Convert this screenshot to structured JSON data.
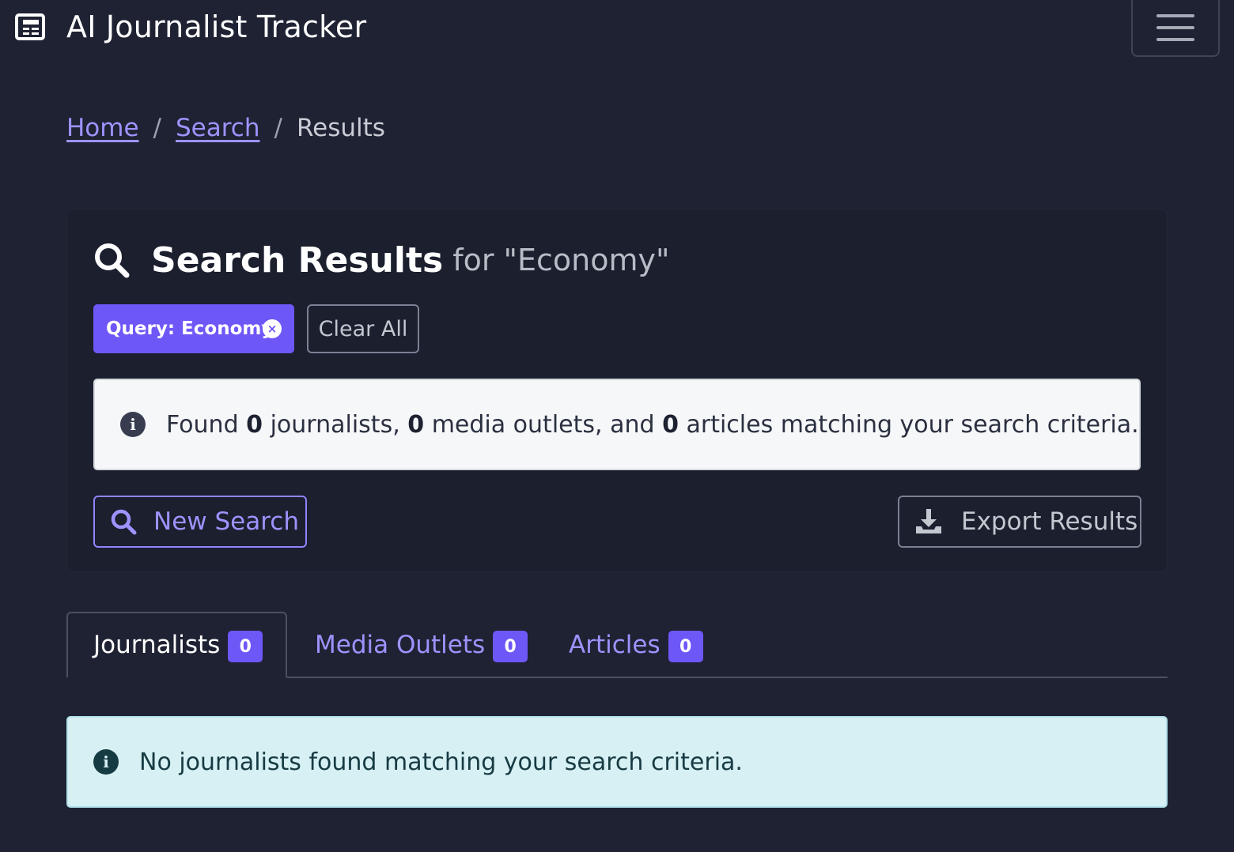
{
  "app": {
    "title": "AI Journalist Tracker",
    "brand_icon": "newspaper-icon",
    "menu_icon": "hamburger-menu-icon"
  },
  "breadcrumb": {
    "items": [
      {
        "label": "Home",
        "link": true
      },
      {
        "label": "Search",
        "link": true
      },
      {
        "label": "Results",
        "link": false
      }
    ],
    "separator": "/"
  },
  "results_card": {
    "title": "Search Results",
    "subtitle": "for \"Economy\"",
    "title_icon": "search-icon",
    "filter_chip": {
      "label": "Query: Economy",
      "remove_icon": "close-circle-icon",
      "remove_glyph": "×"
    },
    "clear_all_label": "Clear All",
    "summary": {
      "prefix": "Found",
      "journalists_count": "0",
      "journalists_text": "journalists,",
      "outlets_count": "0",
      "outlets_text": "media outlets, and",
      "articles_count": "0",
      "articles_text": "articles matching your search criteria.",
      "icon": "info-icon",
      "icon_glyph": "i"
    },
    "new_search_label": "New Search",
    "export_label": "Export Results",
    "export_icon": "download-icon"
  },
  "tabs": [
    {
      "label": "Journalists",
      "count": "0",
      "active": true
    },
    {
      "label": "Media Outlets",
      "count": "0",
      "active": false
    },
    {
      "label": "Articles",
      "count": "0",
      "active": false
    }
  ],
  "empty_state": {
    "message": "No journalists found matching your search criteria.",
    "icon": "info-icon",
    "icon_glyph": "i"
  },
  "colors": {
    "background": "#1e2233",
    "accent": "#6e57f7",
    "link": "#9d93ff",
    "info_bg": "#d7f0f4"
  }
}
